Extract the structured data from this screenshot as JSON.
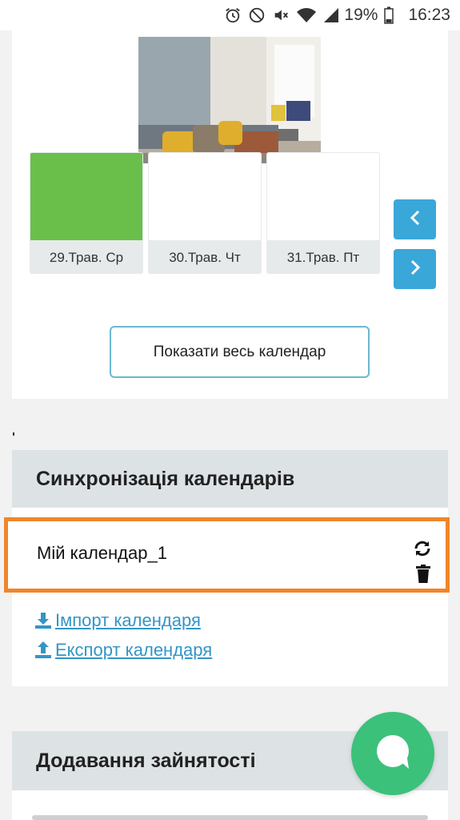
{
  "status_bar": {
    "battery": "19%",
    "time": "16:23",
    "icons": [
      "alarm-icon",
      "do-not-disturb-icon",
      "mute-icon",
      "wifi-icon",
      "signal-icon",
      "battery-icon"
    ]
  },
  "calendar": {
    "days": [
      {
        "label": "29.Трав. Ср",
        "color": "#6abf4b"
      },
      {
        "label": "30.Трав. Чт",
        "color": "#ffffff"
      },
      {
        "label": "31.Трав. Пт",
        "color": "#ffffff"
      }
    ],
    "prev_icon": "chevron-left-icon",
    "next_icon": "chevron-right-icon",
    "show_all_label": "Показати весь календар"
  },
  "sync": {
    "header": "Синхронізація календарів",
    "calendar_name": "Мій календар_1",
    "import_label": " Імпорт календаря",
    "export_label": " Експорт календаря"
  },
  "busy": {
    "header": "Додавання зайнятості"
  },
  "colors": {
    "accent_blue": "#3aa7d9",
    "link_blue": "#3395c7",
    "highlight_orange": "#f0862a",
    "chat_green": "#3cc17a",
    "header_gray": "#dde3e5"
  }
}
